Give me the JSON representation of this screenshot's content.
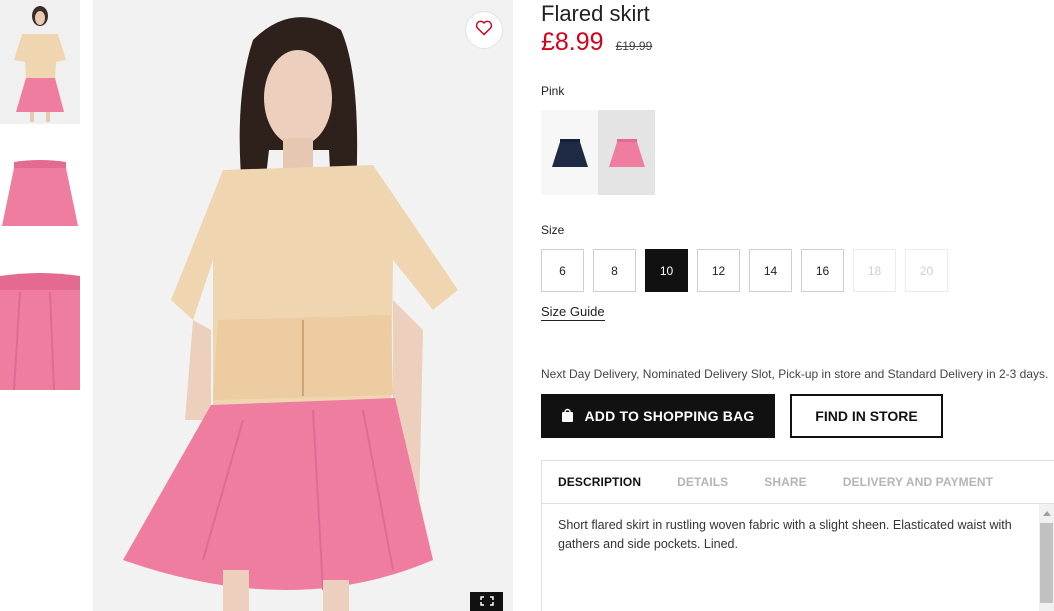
{
  "product": {
    "title": "Flared skirt",
    "price": "£8.99",
    "old_price": "£19.99",
    "color_name": "Pink"
  },
  "colors": [
    {
      "name": "navy",
      "hex": "#1f2a44"
    },
    {
      "name": "pink",
      "hex": "#ee7da0"
    }
  ],
  "size": {
    "label": "Size",
    "options": [
      "6",
      "8",
      "10",
      "12",
      "14",
      "16",
      "18",
      "20"
    ],
    "selected": "10",
    "unavailable": [
      "18",
      "20"
    ],
    "guide_label": "Size Guide"
  },
  "delivery_note": "Next Day Delivery, Nominated Delivery Slot, Pick-up in store and Standard Delivery in 2-3 days.",
  "buttons": {
    "add_to_bag": "ADD TO SHOPPING BAG",
    "find_in_store": "FIND IN STORE"
  },
  "tabs": [
    "DESCRIPTION",
    "DETAILS",
    "SHARE",
    "DELIVERY AND PAYMENT"
  ],
  "active_tab": "DESCRIPTION",
  "description": "Short flared skirt in rustling woven fabric with a slight sheen. Elasticated waist with gathers and side pockets. Lined.",
  "icons": {
    "favorite": "heart-icon",
    "expand": "expand-icon",
    "bag": "shopping-bag-icon"
  },
  "theme": {
    "sale_red": "#d6001c",
    "skirt_pink": "#ee7da0",
    "top_beige": "#f0d6b0",
    "dark": "#111111"
  }
}
